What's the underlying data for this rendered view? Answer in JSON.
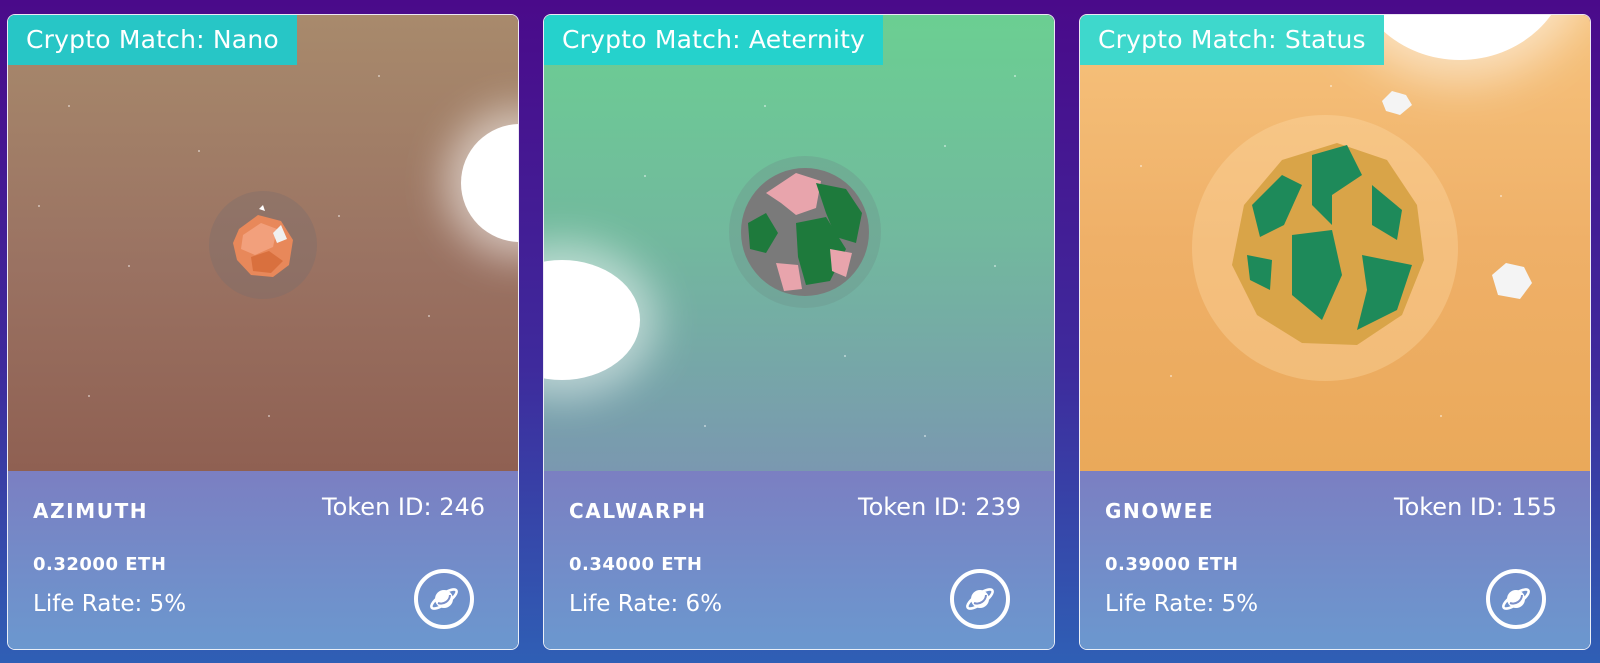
{
  "cards": [
    {
      "badge": "Crypto Match: Nano",
      "badge_color": "#27c6c6",
      "scene_gradient": [
        "#a88a6c",
        "#8f6052"
      ],
      "name": "AZIMUTH",
      "token": "Token ID: 246",
      "price": "0.32000 ETH",
      "life_rate": "Life Rate: 5%",
      "icon": "planet-icon"
    },
    {
      "badge": "Crypto Match: Aeternity",
      "badge_color": "#25d2cc",
      "scene_gradient": [
        "#6bcf92",
        "#7a98b0"
      ],
      "name": "CALWARPH",
      "token": "Token ID: 239",
      "price": "0.34000 ETH",
      "life_rate": "Life Rate: 6%",
      "icon": "planet-icon"
    },
    {
      "badge": "Crypto Match: Status",
      "badge_color": "#3ed8cc",
      "scene_gradient": [
        "#f6c27c",
        "#eaa95a"
      ],
      "name": "GNOWEE",
      "token": "Token ID: 155",
      "price": "0.39000 ETH",
      "life_rate": "Life Rate: 5%",
      "icon": "planet-icon"
    }
  ]
}
